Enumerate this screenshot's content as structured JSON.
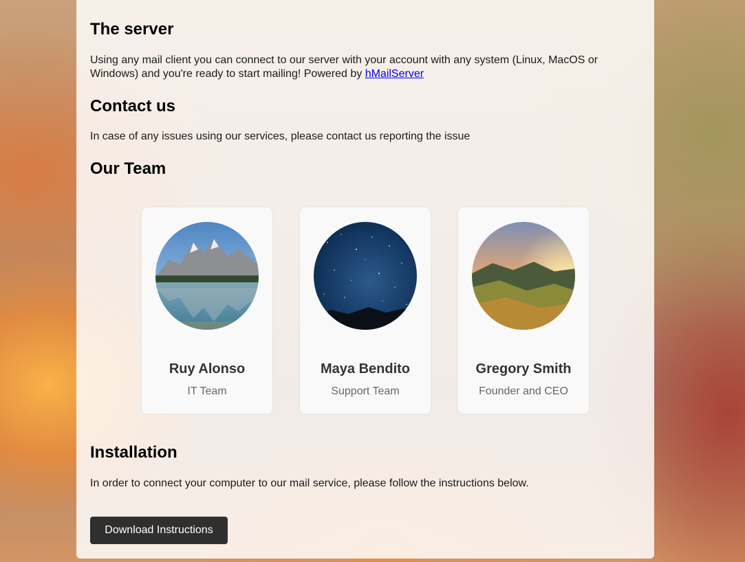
{
  "sections": {
    "server": {
      "title": "The server",
      "text": "Using any mail client you can connect to our server with your account with any system (Linux, MacOS or Windows) and you're ready to start mailing! Powered by ",
      "link_label": "hMailServer"
    },
    "contact": {
      "title": "Contact us",
      "text": "In case of any issues using our services, please contact us reporting the issue"
    },
    "team": {
      "title": "Our Team",
      "members": [
        {
          "name": "Ruy Alonso",
          "role": "IT Team",
          "photo": "mountain-lake-photo"
        },
        {
          "name": "Maya Bendito",
          "role": "Support Team",
          "photo": "night-sky-photo"
        },
        {
          "name": "Gregory Smith",
          "role": "Founder and CEO",
          "photo": "sunset-hills-photo"
        }
      ]
    },
    "installation": {
      "title": "Installation",
      "text": "In order to connect your computer to our mail service, please follow the instructions below.",
      "button_label": "Download Instructions"
    }
  },
  "colors": {
    "button_bg": "#2f2f2f",
    "link": "#0000ee",
    "card_bg": "#ffffff"
  }
}
